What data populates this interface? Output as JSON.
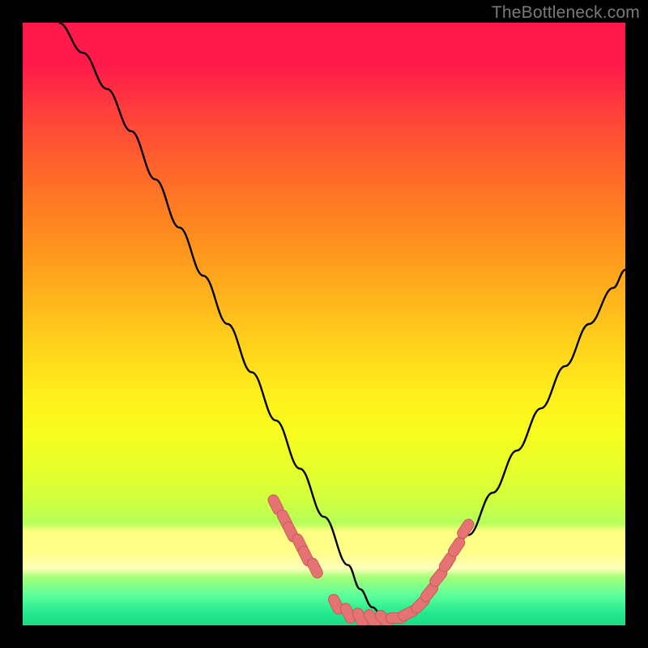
{
  "watermark": "TheBottleneck.com",
  "colors": {
    "background_frame": "#000000",
    "curve": "#000000",
    "marker_fill": "#e57373",
    "marker_stroke": "#c85a5a"
  },
  "chart_data": {
    "type": "line",
    "title": "",
    "xlabel": "",
    "ylabel": "",
    "xlim": [
      0,
      100
    ],
    "ylim": [
      0,
      100
    ],
    "grid": false,
    "legend": null,
    "series": [
      {
        "name": "bottleneck-curve",
        "x": [
          6,
          10,
          14,
          18,
          22,
          26,
          30,
          34,
          38,
          42,
          46,
          50,
          54,
          56,
          58,
          60,
          62,
          64,
          66,
          70,
          74,
          78,
          82,
          86,
          90,
          94,
          98,
          100
        ],
        "y": [
          100,
          95,
          89,
          82,
          74,
          66,
          58,
          50,
          42,
          34,
          26,
          18,
          10,
          6,
          3,
          1,
          1,
          2,
          4,
          9,
          15,
          22,
          29,
          36,
          43,
          50,
          56,
          59
        ]
      }
    ],
    "markers": {
      "name": "highlighted-points",
      "shape": "capsule",
      "x": [
        42,
        43.5,
        44.5,
        46,
        47,
        48.5,
        52,
        54,
        56,
        58,
        60,
        62,
        64,
        66,
        67.5,
        69,
        70.5,
        72,
        73.5
      ],
      "y": [
        20,
        17.5,
        15.5,
        13.5,
        11.5,
        9.5,
        3.5,
        2,
        1.2,
        1,
        1,
        1.2,
        2,
        3.5,
        5.5,
        8,
        10.5,
        13,
        16
      ]
    },
    "gradient_stops": [
      {
        "pos": 0.0,
        "color": "#ff1a4b"
      },
      {
        "pos": 0.3,
        "color": "#ff7a24"
      },
      {
        "pos": 0.62,
        "color": "#fff01c"
      },
      {
        "pos": 0.86,
        "color": "#ffff8a"
      },
      {
        "pos": 0.95,
        "color": "#5cff9a"
      },
      {
        "pos": 1.0,
        "color": "#1bdc86"
      }
    ]
  }
}
